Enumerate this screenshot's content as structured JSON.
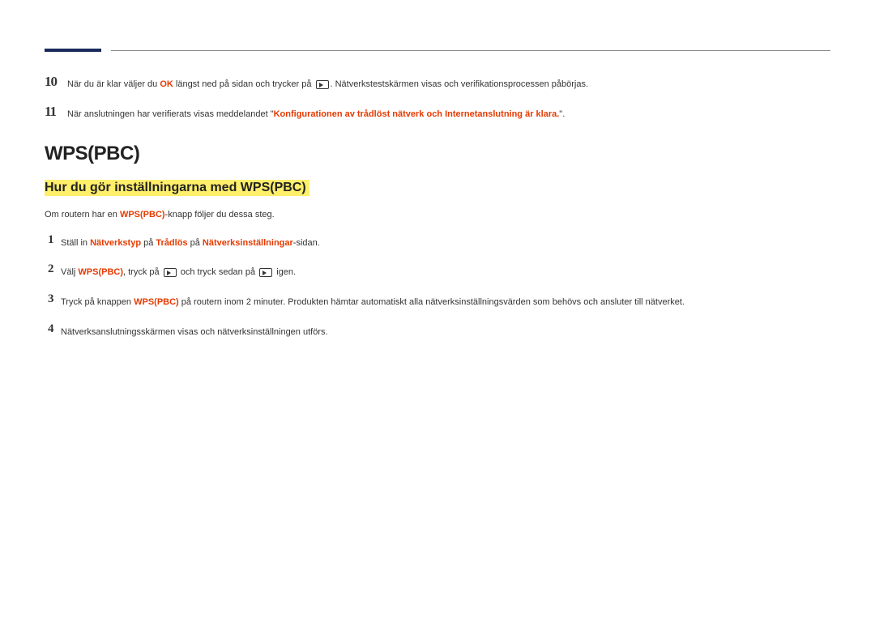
{
  "steps_top": [
    {
      "num": "10",
      "parts": [
        {
          "t": "När du är klar väljer du "
        },
        {
          "t": "OK",
          "red": true
        },
        {
          "t": " längst ned på sidan och trycker på "
        },
        {
          "icon": true
        },
        {
          "t": ". Nätverkstestskärmen visas och verifikationsprocessen påbörjas."
        }
      ]
    },
    {
      "num": "11",
      "parts": [
        {
          "t": "När anslutningen har verifierats visas meddelandet \""
        },
        {
          "t": "Konfigurationen av trådlöst nätverk och Internetanslutning är klara.",
          "red": true
        },
        {
          "t": "\"."
        }
      ]
    }
  ],
  "section_title": "WPS(PBC)",
  "subsection_title": "Hur du gör inställningarna med WPS(PBC)",
  "intro_parts": [
    {
      "t": "Om routern har en "
    },
    {
      "t": "WPS(PBC)",
      "red": true
    },
    {
      "t": "-knapp följer du dessa steg."
    }
  ],
  "steps_bottom": [
    {
      "num": "1",
      "parts": [
        {
          "t": "Ställ in "
        },
        {
          "t": "Nätverkstyp",
          "red": true
        },
        {
          "t": " på "
        },
        {
          "t": "Trådlös",
          "red": true
        },
        {
          "t": " på "
        },
        {
          "t": "Nätverksinställningar",
          "red": true
        },
        {
          "t": "-sidan."
        }
      ]
    },
    {
      "num": "2",
      "parts": [
        {
          "t": "Välj "
        },
        {
          "t": "WPS(PBC)",
          "red": true
        },
        {
          "t": ", tryck på "
        },
        {
          "icon": true
        },
        {
          "t": " och tryck sedan på "
        },
        {
          "icon": true
        },
        {
          "t": " igen."
        }
      ]
    },
    {
      "num": "3",
      "parts": [
        {
          "t": "Tryck på knappen "
        },
        {
          "t": "WPS(PBC) ",
          "red": true
        },
        {
          "t": "på routern inom 2 minuter. Produkten hämtar automatiskt alla nätverksinställningsvärden som behövs och ansluter till nätverket."
        }
      ]
    },
    {
      "num": "4",
      "parts": [
        {
          "t": "Nätverksanslutningsskärmen visas och nätverksinställningen utförs."
        }
      ]
    }
  ]
}
